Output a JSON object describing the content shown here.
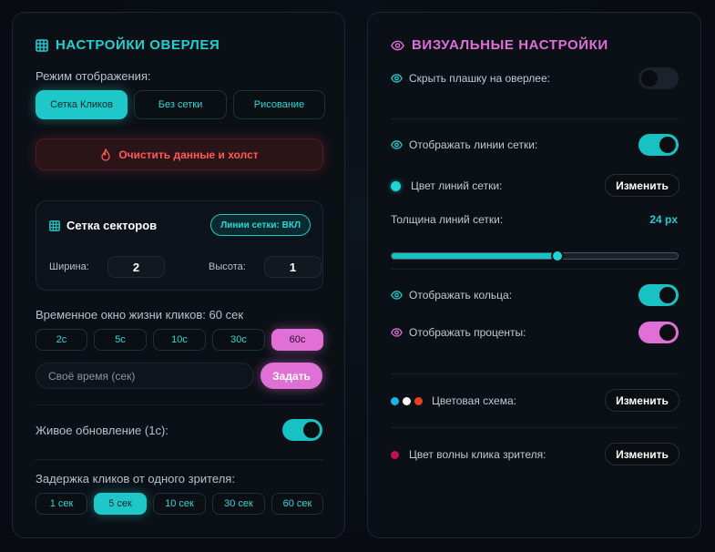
{
  "colors": {
    "teal": "#1ec8c8",
    "pink": "#e170d6",
    "danger": "#ff5a5a"
  },
  "overlay": {
    "title": "НАСТРОЙКИ ОВЕРЛЕЯ",
    "display_mode_label": "Режим отображения:",
    "modes": [
      {
        "label": "Сетка Кликов",
        "active": true
      },
      {
        "label": "Без сетки",
        "active": false
      },
      {
        "label": "Рисование",
        "active": false
      }
    ],
    "clear_label": "Очистить данные и холст",
    "sector_grid": {
      "title": "Сетка секторов",
      "grid_lines_pill": "Линии сетки: ВКЛ",
      "width_label": "Ширина:",
      "width_value": "2",
      "height_label": "Высота:",
      "height_value": "1"
    },
    "lifetime_label": "Временное окно жизни кликов: 60 сек",
    "lifetime_options": [
      {
        "label": "2с",
        "active": false
      },
      {
        "label": "5с",
        "active": false
      },
      {
        "label": "10с",
        "active": false
      },
      {
        "label": "30с",
        "active": false
      },
      {
        "label": "60с",
        "active": true
      }
    ],
    "custom_time_placeholder": "Своё время (сек)",
    "set_button": "Задать",
    "live_update_label": "Живое обновление (1с):",
    "live_update_on": true,
    "delay_label": "Задержка кликов от одного зрителя:",
    "delay_options": [
      {
        "label": "1 сек",
        "active": false
      },
      {
        "label": "5 сек",
        "active": true
      },
      {
        "label": "10 сек",
        "active": false
      },
      {
        "label": "30 сек",
        "active": false
      },
      {
        "label": "60 сек",
        "active": false
      }
    ]
  },
  "visual": {
    "title": "ВИЗУАЛЬНЫЕ НАСТРОЙКИ",
    "hide_plate_label": "Скрыть плашку на оверлее:",
    "hide_plate_on": false,
    "show_grid_lines_label": "Отображать линии сетки:",
    "show_grid_lines_on": true,
    "grid_color_label": "Цвет линий сетки:",
    "grid_color": "#1ed4d4",
    "change_label": "Изменить",
    "thickness_label": "Толщина линий сетки:",
    "thickness_value": "24 px",
    "thickness_fraction": 0.58,
    "show_rings_label": "Отображать кольца:",
    "show_rings_on": true,
    "show_percent_label": "Отображать проценты:",
    "show_percent_on": true,
    "color_scheme_label": "Цветовая схема:",
    "color_scheme_dots": [
      "#14b7e6",
      "#ffffff",
      "#e8401c"
    ],
    "click_wave_label": "Цвет волны клика зрителя:",
    "click_wave_color": "#c0124a"
  }
}
